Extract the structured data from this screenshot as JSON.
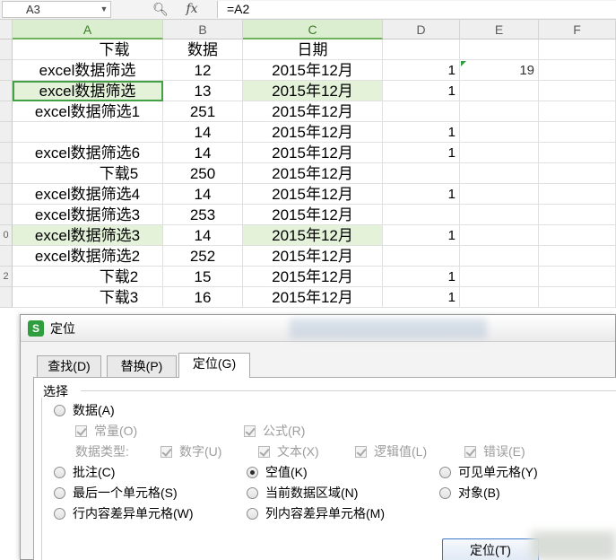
{
  "formula_bar": {
    "name_box": "A3",
    "fx": "fx",
    "formula": "=A2"
  },
  "sheet": {
    "columns": [
      "A",
      "B",
      "C",
      "D",
      "E",
      "F"
    ],
    "row_numbers": [
      "",
      "",
      "",
      "",
      "",
      "",
      "",
      "",
      "0",
      "",
      "2",
      ""
    ],
    "header_row": {
      "a": "下载",
      "b": "数据",
      "c": "日期"
    },
    "rows": [
      {
        "a": "excel数据筛选",
        "b": "12",
        "c": "2015年12月",
        "d": "1",
        "e": "19"
      },
      {
        "a": "excel数据筛选",
        "b": "13",
        "c": "2015年12月",
        "d": "1",
        "e": ""
      },
      {
        "a": "excel数据筛选1",
        "b": "251",
        "c": "2015年12月",
        "d": "",
        "e": ""
      },
      {
        "a": "",
        "b": "14",
        "c": "2015年12月",
        "d": "1",
        "e": ""
      },
      {
        "a": "excel数据筛选6",
        "b": "14",
        "c": "2015年12月",
        "d": "1",
        "e": ""
      },
      {
        "a": "下载5",
        "b": "250",
        "c": "2015年12月",
        "d": "",
        "e": ""
      },
      {
        "a": "excel数据筛选4",
        "b": "14",
        "c": "2015年12月",
        "d": "1",
        "e": ""
      },
      {
        "a": "excel数据筛选3",
        "b": "253",
        "c": "2015年12月",
        "d": "",
        "e": ""
      },
      {
        "a": "excel数据筛选3",
        "b": "14",
        "c": "2015年12月",
        "d": "1",
        "e": ""
      },
      {
        "a": "excel数据筛选2",
        "b": "252",
        "c": "2015年12月",
        "d": "",
        "e": ""
      },
      {
        "a": "下载2",
        "b": "15",
        "c": "2015年12月",
        "d": "1",
        "e": ""
      },
      {
        "a": "下载3",
        "b": "16",
        "c": "2015年12月",
        "d": "1",
        "e": ""
      }
    ]
  },
  "dialog": {
    "title": "定位",
    "icon_letter": "S",
    "tabs": [
      "查找(D)",
      "替换(P)",
      "定位(G)"
    ],
    "group_label": "选择",
    "options": {
      "data": "数据(A)",
      "constant": "常量(O)",
      "formula": "公式(R)",
      "data_type_label": "数据类型:",
      "number": "数字(U)",
      "text": "文本(X)",
      "logical": "逻辑值(L)",
      "error": "错误(E)",
      "comment": "批注(C)",
      "blank": "空值(K)",
      "visible_cells": "可见单元格(Y)",
      "last_cell": "最后一个单元格(S)",
      "current_region": "当前数据区域(N)",
      "objects": "对象(B)",
      "row_diff": "行内容差异单元格(W)",
      "col_diff": "列内容差异单元格(M)"
    },
    "locate_button": "定位(T)"
  }
}
